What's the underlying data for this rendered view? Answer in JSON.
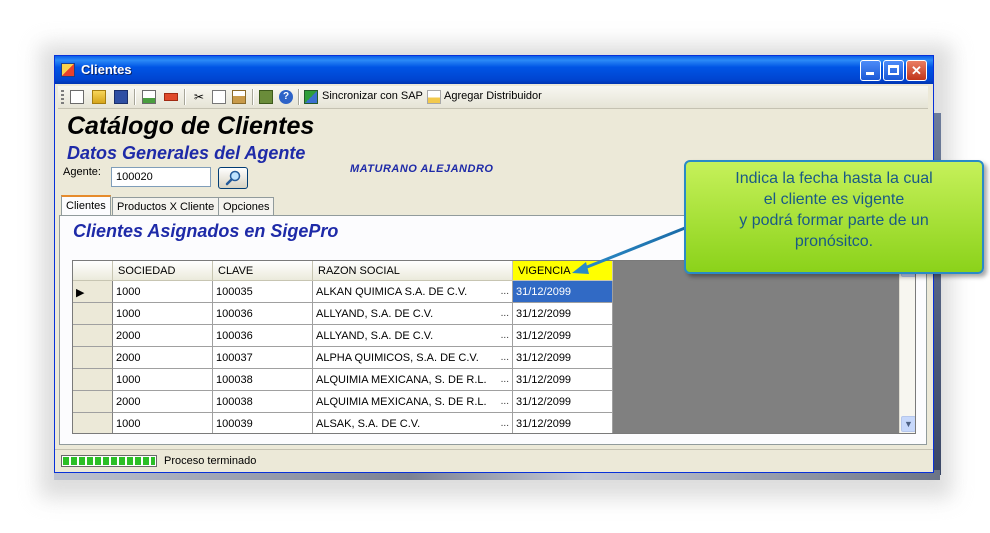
{
  "window": {
    "title": "Clientes",
    "controls": {
      "minimize": "_",
      "maximize": "□",
      "close": "✕"
    }
  },
  "toolbar": {
    "buttons": [
      "new-icon",
      "open-icon",
      "save-icon",
      "doc-icon",
      "delete-icon",
      "cut-icon",
      "copy-icon",
      "paste-icon",
      "export-icon",
      "help-icon"
    ],
    "sync_label": "Sincronizar con SAP",
    "add_label": "Agregar Distribuidor"
  },
  "header": {
    "title": "Catálogo de Clientes",
    "subtitle": "Datos Generales del Agente",
    "agent_label": "Agente:",
    "agent_value": "100020",
    "agent_name": "MATURANO ALEJANDRO"
  },
  "tabs": [
    {
      "label": "Clientes",
      "active": true
    },
    {
      "label": "Productos X Cliente",
      "active": false
    },
    {
      "label": "Opciones",
      "active": false
    }
  ],
  "panel": {
    "title": "Clientes Asignados en SigePro"
  },
  "grid": {
    "columns": [
      "SOCIEDAD",
      "CLAVE",
      "RAZON SOCIAL",
      "VIGENCIA"
    ],
    "highlight_column": "VIGENCIA",
    "highlight_color": "#ffff00",
    "rows": [
      {
        "sociedad": "1000",
        "clave": "100035",
        "razon": "ALKAN QUIMICA S.A. DE C.V.",
        "vigencia": "31/12/2099",
        "current": true
      },
      {
        "sociedad": "1000",
        "clave": "100036",
        "razon": "ALLYAND, S.A. DE C.V.",
        "vigencia": "31/12/2099"
      },
      {
        "sociedad": "2000",
        "clave": "100036",
        "razon": "ALLYAND, S.A. DE C.V.",
        "vigencia": "31/12/2099"
      },
      {
        "sociedad": "2000",
        "clave": "100037",
        "razon": "ALPHA QUIMICOS, S.A. DE C.V.",
        "vigencia": "31/12/2099"
      },
      {
        "sociedad": "1000",
        "clave": "100038",
        "razon": "ALQUIMIA MEXICANA, S. DE R.L.",
        "vigencia": "31/12/2099"
      },
      {
        "sociedad": "2000",
        "clave": "100038",
        "razon": "ALQUIMIA MEXICANA, S. DE R.L.",
        "vigencia": "31/12/2099"
      },
      {
        "sociedad": "1000",
        "clave": "100039",
        "razon": "ALSAK, S.A. DE C.V.",
        "vigencia": "31/12/2099"
      }
    ],
    "row_indicator": "▶",
    "ellipsis": "..."
  },
  "status": {
    "progress": 1.0,
    "text": "Proceso terminado"
  },
  "callout": {
    "lines": [
      "Indica la fecha hasta la cual",
      "el cliente es vigente",
      "y podrá formar parte de un",
      "pronósitco."
    ],
    "fill_color": "#9ee02e",
    "border_color": "#2a8ac6"
  },
  "colors": {
    "title_blue": "#1e2aa8",
    "selection": "#316ac5",
    "accent_orange": "#e68b2c"
  }
}
